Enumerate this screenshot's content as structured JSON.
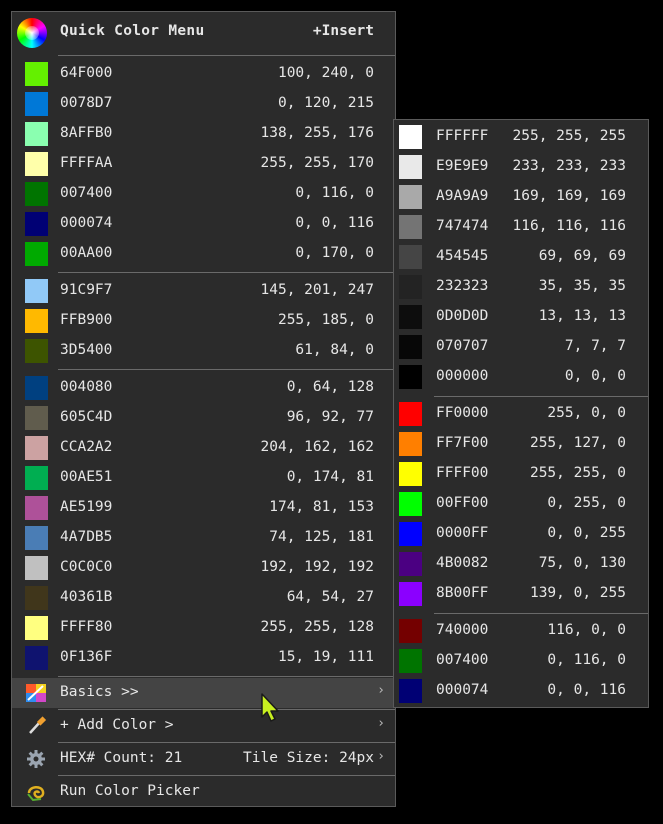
{
  "menu": {
    "title": "Quick Color Menu",
    "insert": "+Insert",
    "groups": [
      [
        {
          "hex": "64F000",
          "rgb": "100, 240, 0",
          "color": "#64F000"
        },
        {
          "hex": "0078D7",
          "rgb": "0, 120, 215",
          "color": "#0078D7"
        },
        {
          "hex": "8AFFB0",
          "rgb": "138, 255, 176",
          "color": "#8AFFB0"
        },
        {
          "hex": "FFFFAA",
          "rgb": "255, 255, 170",
          "color": "#FFFFAA"
        },
        {
          "hex": "007400",
          "rgb": "0, 116, 0",
          "color": "#007400"
        },
        {
          "hex": "000074",
          "rgb": "0, 0, 116",
          "color": "#000074"
        },
        {
          "hex": "00AA00",
          "rgb": "0, 170, 0",
          "color": "#00AA00"
        }
      ],
      [
        {
          "hex": "91C9F7",
          "rgb": "145, 201, 247",
          "color": "#91C9F7"
        },
        {
          "hex": "FFB900",
          "rgb": "255, 185, 0",
          "color": "#FFB900"
        },
        {
          "hex": "3D5400",
          "rgb": "61, 84, 0",
          "color": "#3D5400"
        }
      ],
      [
        {
          "hex": "004080",
          "rgb": "0, 64, 128",
          "color": "#004080"
        },
        {
          "hex": "605C4D",
          "rgb": "96, 92, 77",
          "color": "#605C4D"
        },
        {
          "hex": "CCA2A2",
          "rgb": "204, 162, 162",
          "color": "#CCA2A2"
        },
        {
          "hex": "00AE51",
          "rgb": "0, 174, 81",
          "color": "#00AE51"
        },
        {
          "hex": "AE5199",
          "rgb": "174, 81, 153",
          "color": "#AE5199"
        },
        {
          "hex": "4A7DB5",
          "rgb": "74, 125, 181",
          "color": "#4A7DB5"
        },
        {
          "hex": "C0C0C0",
          "rgb": "192, 192, 192",
          "color": "#C0C0C0"
        },
        {
          "hex": "40361B",
          "rgb": "64, 54, 27",
          "color": "#40361B"
        },
        {
          "hex": "FFFF80",
          "rgb": "255, 255, 128",
          "color": "#FFFF80"
        },
        {
          "hex": "0F136F",
          "rgb": "15, 19, 111",
          "color": "#0F136F"
        }
      ]
    ],
    "actions": {
      "basics": "Basics >>",
      "add_color": "+ Add Color >",
      "hex_count": "HEX# Count: 21",
      "tile_size": "Tile Size: 24px",
      "run_picker": "Run Color Picker"
    }
  },
  "submenu": {
    "groups": [
      [
        {
          "hex": "FFFFFF",
          "rgb": "255, 255, 255",
          "color": "#FFFFFF"
        },
        {
          "hex": "E9E9E9",
          "rgb": "233, 233, 233",
          "color": "#E9E9E9"
        },
        {
          "hex": "A9A9A9",
          "rgb": "169, 169, 169",
          "color": "#A9A9A9"
        },
        {
          "hex": "747474",
          "rgb": "116, 116, 116",
          "color": "#747474"
        },
        {
          "hex": "454545",
          "rgb": "69, 69, 69",
          "color": "#454545"
        },
        {
          "hex": "232323",
          "rgb": "35, 35, 35",
          "color": "#232323"
        },
        {
          "hex": "0D0D0D",
          "rgb": "13, 13, 13",
          "color": "#0D0D0D"
        },
        {
          "hex": "070707",
          "rgb": "7, 7, 7",
          "color": "#070707"
        },
        {
          "hex": "000000",
          "rgb": "0, 0, 0",
          "color": "#000000"
        }
      ],
      [
        {
          "hex": "FF0000",
          "rgb": "255, 0, 0",
          "color": "#FF0000"
        },
        {
          "hex": "FF7F00",
          "rgb": "255, 127, 0",
          "color": "#FF7F00"
        },
        {
          "hex": "FFFF00",
          "rgb": "255, 255, 0",
          "color": "#FFFF00"
        },
        {
          "hex": "00FF00",
          "rgb": "0, 255, 0",
          "color": "#00FF00"
        },
        {
          "hex": "0000FF",
          "rgb": "0, 0, 255",
          "color": "#0000FF"
        },
        {
          "hex": "4B0082",
          "rgb": "75, 0, 130",
          "color": "#4B0082"
        },
        {
          "hex": "8B00FF",
          "rgb": "139, 0, 255",
          "color": "#8B00FF"
        }
      ],
      [
        {
          "hex": "740000",
          "rgb": "116, 0, 0",
          "color": "#740000"
        },
        {
          "hex": "007400",
          "rgb": "0, 116, 0",
          "color": "#007400"
        },
        {
          "hex": "000074",
          "rgb": "0, 0, 116",
          "color": "#000074"
        }
      ]
    ]
  },
  "icons": {
    "header": "color-wheel-icon",
    "basics": "palette-icon",
    "add_color": "eyedropper-icon",
    "settings": "gear-icon",
    "picker": "chameleon-icon",
    "cursor": "mouse-pointer-icon"
  }
}
